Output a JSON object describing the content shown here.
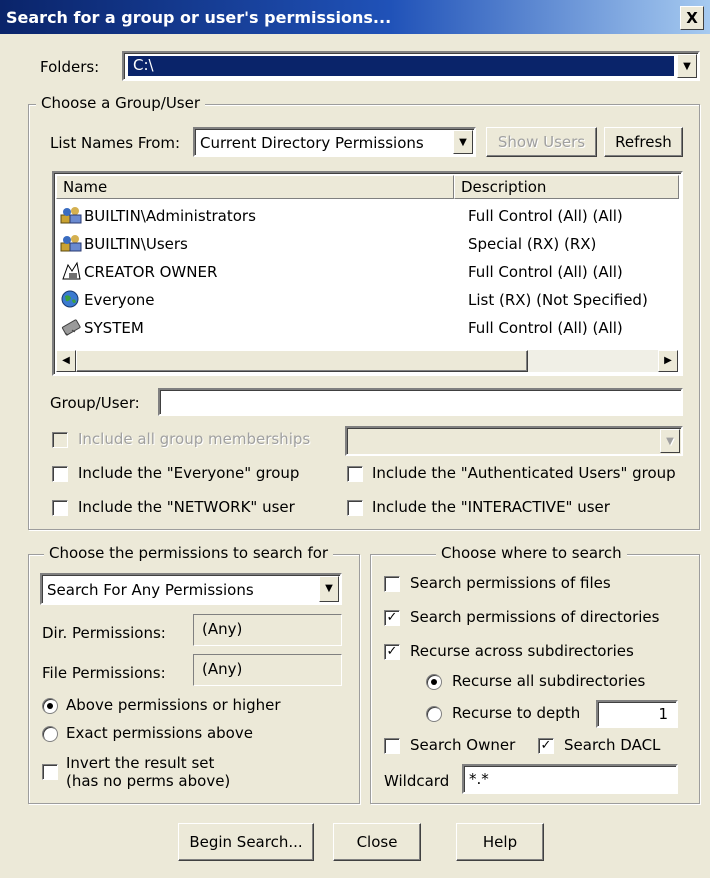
{
  "window": {
    "title": "Search for a group or user's permissions...",
    "close_label": "X"
  },
  "folders": {
    "label": "Folders:",
    "value": "C:\\"
  },
  "group_user_section": {
    "legend": "Choose a Group/User",
    "list_names_from_label": "List Names From:",
    "list_names_from_value": "Current Directory Permissions",
    "show_users_label": "Show Users",
    "refresh_label": "Refresh",
    "columns": [
      "Name",
      "Description"
    ],
    "rows": [
      {
        "name": "BUILTIN\\Administrators",
        "description": "Full Control (All) (All)",
        "icon": "group-icon"
      },
      {
        "name": "BUILTIN\\Users",
        "description": "Special (RX) (RX)",
        "icon": "group-icon"
      },
      {
        "name": "CREATOR OWNER",
        "description": "Full Control (All) (All)",
        "icon": "creator-owner-icon"
      },
      {
        "name": "Everyone",
        "description": "List (RX) (Not Specified)",
        "icon": "globe-icon"
      },
      {
        "name": "SYSTEM",
        "description": "Full Control (All) (All)",
        "icon": "system-chip-icon"
      }
    ],
    "group_user_label": "Group/User:",
    "group_user_value": "",
    "include_all_memberships_label": "Include all group memberships",
    "include_everyone_label": "Include the \"Everyone\" group",
    "include_authenticated_label": "Include the \"Authenticated Users\" group",
    "include_network_label": "Include the \"NETWORK\" user",
    "include_interactive_label": "Include the \"INTERACTIVE\" user"
  },
  "permissions_section": {
    "legend": "Choose the permissions to search for",
    "search_for_value": "Search For Any Permissions",
    "dir_permissions_label": "Dir. Permissions:",
    "dir_permissions_value": "(Any)",
    "file_permissions_label": "File Permissions:",
    "file_permissions_value": "(Any)",
    "above_or_higher_label": "Above permissions or higher",
    "exact_label": "Exact permissions above",
    "invert_label_line1": "Invert the result set",
    "invert_label_line2": "(has no perms above)"
  },
  "where_section": {
    "legend": "Choose where to search",
    "search_files_label": "Search permissions of files",
    "search_files_checked": false,
    "search_dirs_label": "Search permissions of directories",
    "search_dirs_checked": true,
    "recurse_label": "Recurse across subdirectories",
    "recurse_checked": true,
    "recurse_all_label": "Recurse all subdirectories",
    "recurse_depth_label": "Recurse to depth",
    "recurse_depth_value": "1",
    "search_owner_label": "Search Owner",
    "search_owner_checked": false,
    "search_dacl_label": "Search DACL",
    "search_dacl_checked": true,
    "wildcard_label": "Wildcard",
    "wildcard_value": "*.*"
  },
  "buttons": {
    "begin_search": "Begin Search...",
    "close": "Close",
    "help": "Help"
  },
  "colors": {
    "title_start": "#0a246a",
    "title_end": "#a6caf0",
    "selection": "#0a246a",
    "face": "#ece9d8"
  }
}
